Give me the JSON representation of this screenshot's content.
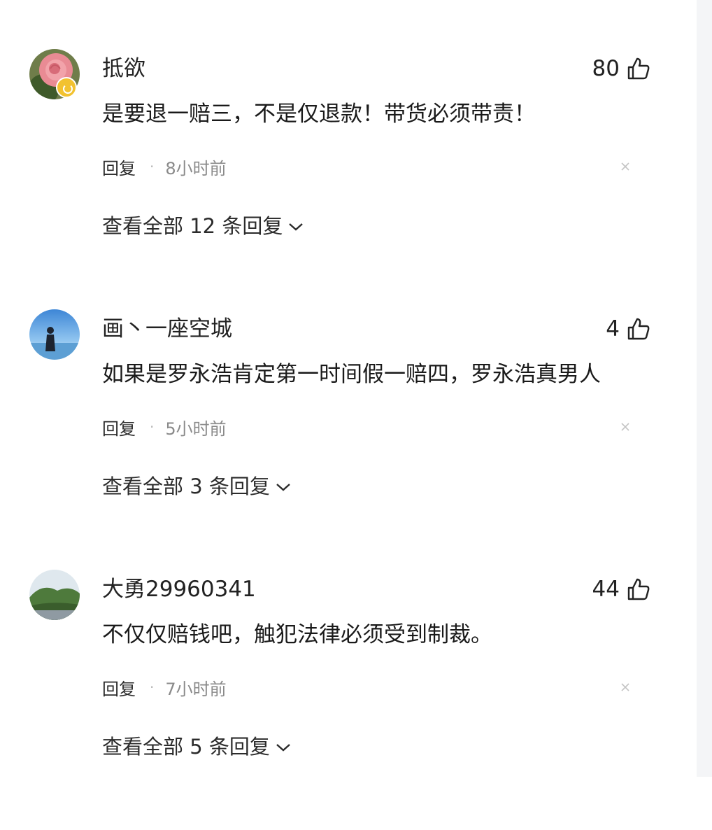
{
  "comments": [
    {
      "username": "抵欲",
      "likes": "80",
      "text": "是要退一赔三，不是仅退款！带货必须带责！",
      "reply_label": "回复",
      "dot": "·",
      "time": "8小时前",
      "view_all": "查看全部 12 条回复",
      "avatar": "rose-photo",
      "has_badge": true
    },
    {
      "username": "画丶一座空城",
      "likes": "4",
      "text": "如果是罗永浩肯定第一时间假一赔四，罗永浩真男人",
      "reply_label": "回复",
      "dot": "·",
      "time": "5小时前",
      "view_all": "查看全部 3 条回复",
      "avatar": "person-by-water-photo",
      "has_badge": false
    },
    {
      "username": "大勇29960341",
      "likes": "44",
      "text": "不仅仅赔钱吧，触犯法律必须受到制裁。",
      "reply_label": "回复",
      "dot": "·",
      "time": "7小时前",
      "view_all": "查看全部 5 条回复",
      "avatar": "landscape-photo",
      "has_badge": false
    }
  ],
  "icons": {
    "like": "thumbs-up-icon",
    "dismiss": "close-icon",
    "expand": "chevron-down-icon",
    "badge": "verified-badge-icon"
  },
  "colors": {
    "text": "#222222",
    "meta": "#8a8a8a",
    "background": "#ffffff"
  }
}
